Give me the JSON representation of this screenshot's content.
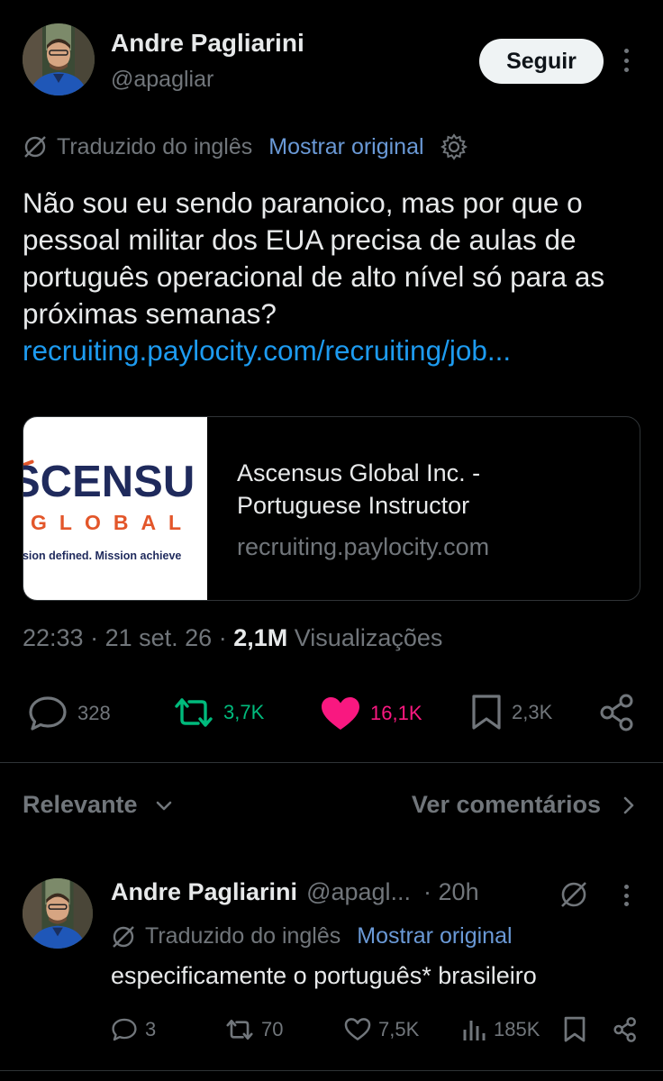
{
  "post": {
    "author_name": "Andre Pagliarini",
    "author_handle": "@apagliar",
    "follow_label": "Seguir",
    "translated_label": "Traduzido do inglês",
    "show_original_label": "Mostrar original",
    "text": "Não sou eu sendo paranoico, mas por que o pessoal militar dos EUA precisa de aulas de português operacional de alto nível só para as próximas semanas?",
    "link_text": "recruiting.paylocity.com/recruiting/job...",
    "card": {
      "logo_main": "SCENSU",
      "logo_sub": "GLOBAL",
      "logo_tag": "ssion defined. Mission achieve",
      "title": "Ascensus Global Inc. - Portuguese Instructor",
      "domain": "recruiting.paylocity.com"
    },
    "time": "22:33",
    "date": "21 set. 26",
    "views": "2,1M",
    "views_label": "Visualizações",
    "sep": "·",
    "replies": "328",
    "reposts": "3,7K",
    "likes": "16,1K",
    "bookmarks": "2,3K"
  },
  "sort": {
    "label": "Relevante",
    "comments_label": "Ver comentários"
  },
  "reply": {
    "author_name": "Andre Pagliarini",
    "author_handle": "@apagl...",
    "age": "· 20h",
    "translated_label": "Traduzido do inglês",
    "show_original_label": "Mostrar original",
    "text": "especificamente o português* brasileiro",
    "replies": "3",
    "reposts": "70",
    "likes": "7,5K",
    "views": "185K"
  },
  "colors": {
    "repost": "#00ba7c",
    "like": "#f91880",
    "link": "#1d9bf0",
    "muted": "#71767b"
  },
  "icons": [
    "translate-icon",
    "gear-icon",
    "reply-icon",
    "repost-icon",
    "heart-icon",
    "bookmark-icon",
    "share-icon",
    "chevron-down-icon",
    "chevron-right-icon",
    "views-icon",
    "more-icon"
  ]
}
